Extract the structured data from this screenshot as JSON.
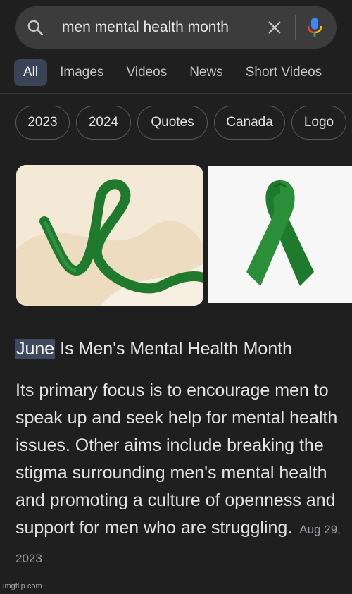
{
  "search": {
    "query": "men mental health month"
  },
  "tabs": [
    {
      "label": "All",
      "active": true
    },
    {
      "label": "Images"
    },
    {
      "label": "Videos"
    },
    {
      "label": "News"
    },
    {
      "label": "Short Videos"
    }
  ],
  "chips": [
    "2023",
    "2024",
    "Quotes",
    "Canada",
    "Logo"
  ],
  "result": {
    "title_highlight": "June",
    "title_rest": " Is Men's Mental Health Month",
    "body": "Its primary focus is to encourage men to speak up and seek help for mental health issues. Other aims include breaking the stigma surrounding men's mental health and promoting a culture of openness and support for men who are struggling.",
    "date": "Aug 29, 2023"
  },
  "watermark": "imgflip.com",
  "colors": {
    "background": "#1f1f1f",
    "search_bar": "#3c3c3c",
    "active_tab": "#394457",
    "ribbon_green": "#1f7a2e"
  },
  "icons": {
    "search": "search-icon",
    "clear": "close-icon",
    "mic": "microphone-icon"
  }
}
